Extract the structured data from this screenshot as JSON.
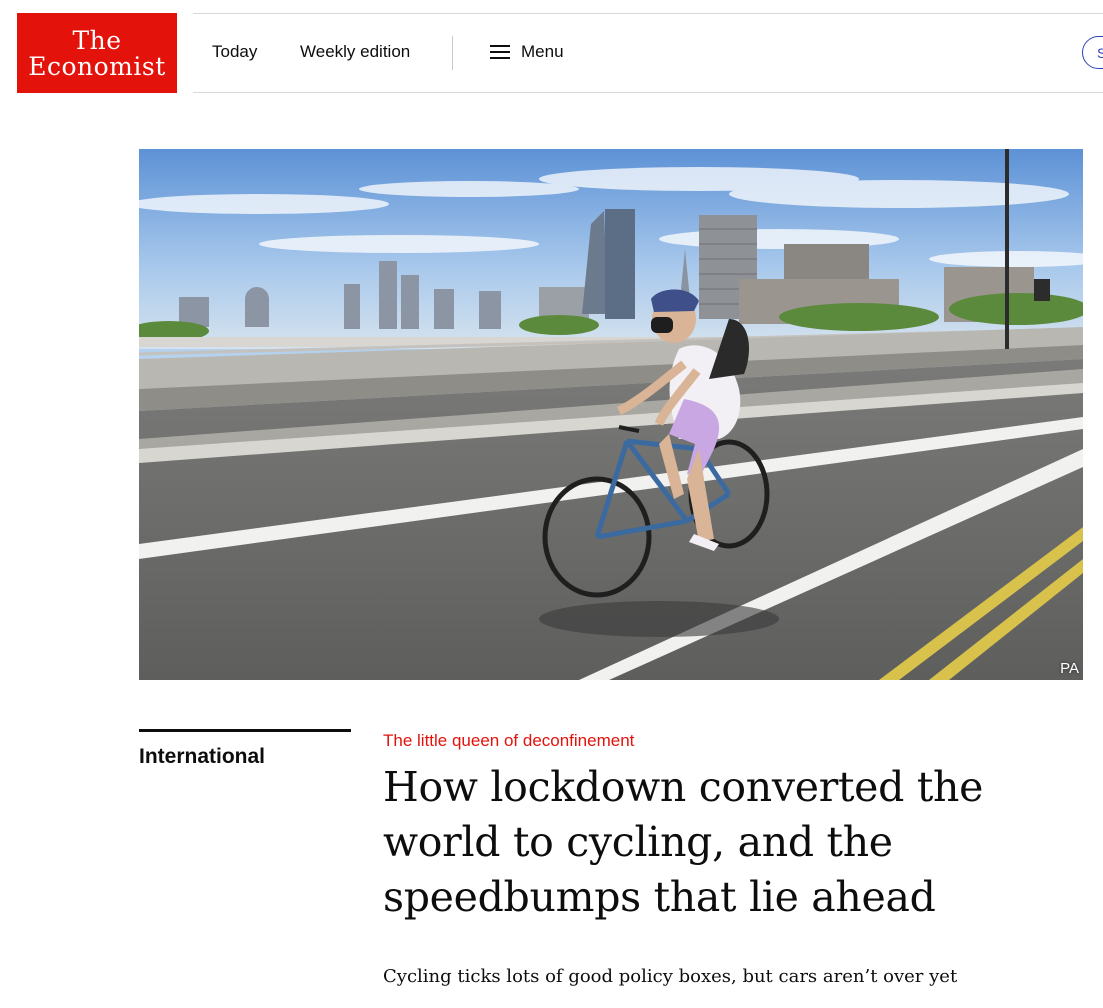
{
  "brand": {
    "logo_line1": "The",
    "logo_line2": "Economist",
    "brand_color": "#e3120b"
  },
  "nav": {
    "today": "Today",
    "weekly_edition": "Weekly edition",
    "menu": "Menu",
    "subscribe": "S"
  },
  "hero": {
    "photo_credit": "PA"
  },
  "article": {
    "section": "International",
    "rubric": "The little queen of deconfinement",
    "headline": "How lockdown converted the world to cycling, and the speedbumps that lie ahead",
    "standfirst": "Cycling ticks lots of good policy boxes, but cars aren’t over yet",
    "rubric_color": "#e3120b"
  },
  "icons": {
    "menu": "hamburger-icon"
  }
}
